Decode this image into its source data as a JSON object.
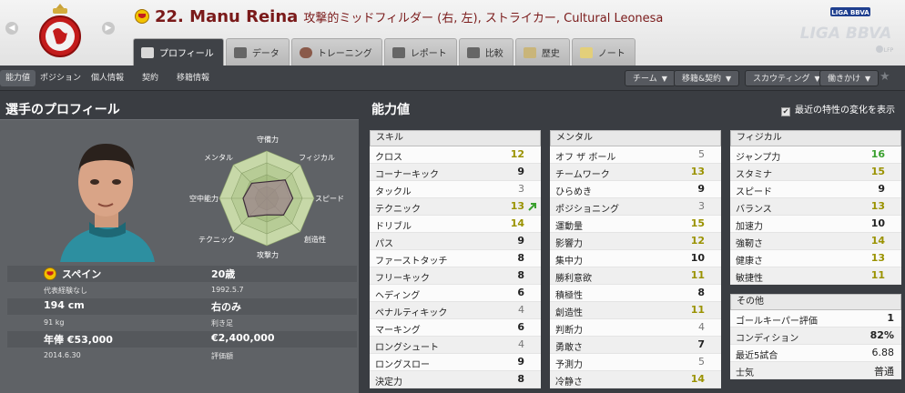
{
  "header": {
    "player_title": "22. Manu Reina",
    "player_subtitle": "攻撃的ミッドフィルダー (右, 左), ストライカー, Cultural Leonesa",
    "league_logo_text": "LIGA BBVA",
    "league_logo_small": "LIGA BBVA",
    "league_sub": "LFP"
  },
  "tabs": [
    {
      "label": "プロフィール",
      "icon": "profile-icon"
    },
    {
      "label": "データ",
      "icon": "stats-icon"
    },
    {
      "label": "トレーニング",
      "icon": "training-icon"
    },
    {
      "label": "レポート",
      "icon": "report-icon"
    },
    {
      "label": "比較",
      "icon": "compare-icon"
    },
    {
      "label": "歴史",
      "icon": "history-icon"
    },
    {
      "label": "ノート",
      "icon": "note-icon"
    }
  ],
  "subnav": {
    "items": [
      "能力値",
      "ポジション",
      "個人情報",
      "契約",
      "移籍情報"
    ],
    "dropdowns": [
      "チーム",
      "移籍&契約",
      "スカウティング",
      "働きかけ"
    ]
  },
  "profile": {
    "heading": "選手のプロフィール",
    "radar_labels": [
      "守備力",
      "フィジカル",
      "スピード",
      "創造性",
      "攻撃力",
      "テクニック",
      "空中能力",
      "メンタル"
    ],
    "radar_values": [
      0.35,
      0.55,
      0.55,
      0.5,
      0.35,
      0.55,
      0.5,
      0.45
    ],
    "rows": [
      {
        "left_main": "スペイン",
        "left_small": "代表経験なし",
        "right_main": "20歳",
        "right_small": "1992.5.7"
      },
      {
        "left_main": "194 cm",
        "left_small": "91 kg",
        "right_main": "右のみ",
        "right_small": "利き足"
      },
      {
        "left_main": "年俸 €53,000",
        "left_small": "2014.6.30",
        "right_main": "€2,400,000",
        "right_small": "評価額"
      }
    ]
  },
  "attributes": {
    "heading": "能力値",
    "show_changes": "最近の特性の変化を表示",
    "technical": {
      "title": "スキル",
      "items": [
        {
          "name": "クロス",
          "value": "12",
          "tone": "y"
        },
        {
          "name": "コーナーキック",
          "value": "9",
          "tone": "d"
        },
        {
          "name": "タックル",
          "value": "3",
          "tone": "g"
        },
        {
          "name": "テクニック",
          "value": "13",
          "tone": "y"
        },
        {
          "name": "ドリブル",
          "value": "14",
          "tone": "y"
        },
        {
          "name": "パス",
          "value": "9",
          "tone": "d"
        },
        {
          "name": "ファーストタッチ",
          "value": "8",
          "tone": "d"
        },
        {
          "name": "フリーキック",
          "value": "8",
          "tone": "d"
        },
        {
          "name": "ヘディング",
          "value": "6",
          "tone": "d"
        },
        {
          "name": "ペナルティキック",
          "value": "4",
          "tone": "g"
        },
        {
          "name": "マーキング",
          "value": "6",
          "tone": "d"
        },
        {
          "name": "ロングシュート",
          "value": "4",
          "tone": "g"
        },
        {
          "name": "ロングスロー",
          "value": "9",
          "tone": "d"
        },
        {
          "name": "決定力",
          "value": "8",
          "tone": "d"
        }
      ]
    },
    "mental": {
      "title": "メンタル",
      "items": [
        {
          "name": "オフ ザ ボール",
          "value": "5",
          "tone": "g"
        },
        {
          "name": "チームワーク",
          "value": "13",
          "tone": "y"
        },
        {
          "name": "ひらめき",
          "value": "9",
          "tone": "d"
        },
        {
          "name": "ポジショニング",
          "value": "3",
          "tone": "g"
        },
        {
          "name": "運動量",
          "value": "15",
          "tone": "y"
        },
        {
          "name": "影響力",
          "value": "12",
          "tone": "y"
        },
        {
          "name": "集中力",
          "value": "10",
          "tone": "d"
        },
        {
          "name": "勝利意欲",
          "value": "11",
          "tone": "y"
        },
        {
          "name": "積極性",
          "value": "8",
          "tone": "d"
        },
        {
          "name": "創造性",
          "value": "11",
          "tone": "y"
        },
        {
          "name": "判断力",
          "value": "4",
          "tone": "g"
        },
        {
          "name": "勇敢さ",
          "value": "7",
          "tone": "d"
        },
        {
          "name": "予測力",
          "value": "5",
          "tone": "g"
        },
        {
          "name": "冷静さ",
          "value": "14",
          "tone": "y"
        }
      ]
    },
    "physical": {
      "title": "フィジカル",
      "items": [
        {
          "name": "ジャンプ力",
          "value": "16",
          "tone": "gr"
        },
        {
          "name": "スタミナ",
          "value": "15",
          "tone": "y"
        },
        {
          "name": "スピード",
          "value": "9",
          "tone": "d"
        },
        {
          "name": "バランス",
          "value": "13",
          "tone": "y"
        },
        {
          "name": "加速力",
          "value": "10",
          "tone": "d"
        },
        {
          "name": "強靭さ",
          "value": "14",
          "tone": "y"
        },
        {
          "name": "健康さ",
          "value": "13",
          "tone": "y"
        },
        {
          "name": "敏捷性",
          "value": "11",
          "tone": "y"
        }
      ]
    },
    "other": {
      "title": "その他",
      "items": [
        {
          "name": "ゴールキーパー評価",
          "value": "1"
        },
        {
          "name": "コンディション",
          "value": "82%"
        },
        {
          "name": "最近5試合",
          "value": "6.88"
        },
        {
          "name": "士気",
          "value": "普通"
        }
      ]
    }
  },
  "colors": {
    "value_yellow": "#9a9200",
    "value_green": "#3aa02e",
    "panel": "#5f6266"
  }
}
